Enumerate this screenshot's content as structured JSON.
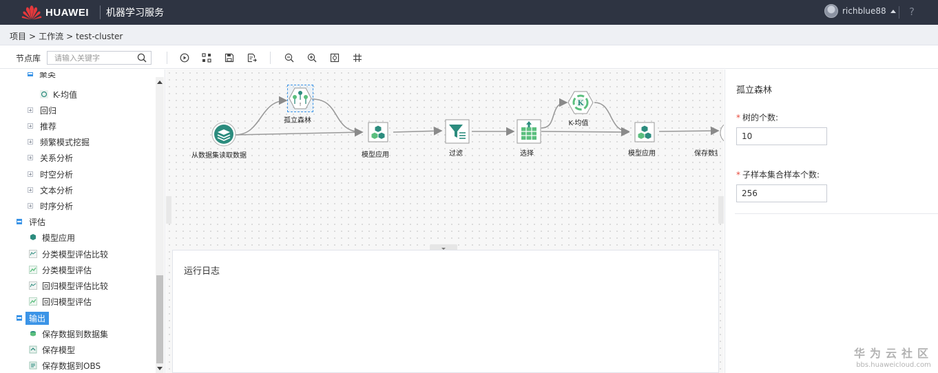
{
  "header": {
    "brand": "HUAWEI",
    "product": "机器学习服务",
    "username": "richblue88",
    "help_label": "?"
  },
  "breadcrumb": [
    "项目",
    ">",
    "工作流",
    ">",
    "test-cluster"
  ],
  "toolbar": {
    "library_label": "节点库",
    "search_placeholder": "请输入关键字",
    "buttons": [
      "run-icon",
      "layout-icon",
      "save-icon",
      "export-icon",
      "zoom-out-icon",
      "zoom-in-icon",
      "fit-screen-icon",
      "grid-icon"
    ]
  },
  "tree": {
    "cut_top_label": "聚类",
    "items": [
      {
        "label": "K-均值",
        "type": "leaf"
      },
      {
        "label": "回归",
        "type": "collapsed"
      },
      {
        "label": "推荐",
        "type": "collapsed"
      },
      {
        "label": "频繁模式挖掘",
        "type": "collapsed"
      },
      {
        "label": "关系分析",
        "type": "collapsed"
      },
      {
        "label": "时空分析",
        "type": "collapsed"
      },
      {
        "label": "文本分析",
        "type": "collapsed"
      },
      {
        "label": "时序分析",
        "type": "collapsed"
      },
      {
        "label": "评估",
        "type": "expanded"
      },
      {
        "label": "模型应用",
        "type": "leaf"
      },
      {
        "label": "分类模型评估比较",
        "type": "leaf"
      },
      {
        "label": "分类模型评估",
        "type": "leaf"
      },
      {
        "label": "回归模型评估比较",
        "type": "leaf"
      },
      {
        "label": "回归模型评估",
        "type": "leaf"
      },
      {
        "label": "输出",
        "type": "expanded-selected"
      },
      {
        "label": "保存数据到数据集",
        "type": "leaf"
      },
      {
        "label": "保存模型",
        "type": "leaf"
      },
      {
        "label": "保存数据到OBS",
        "type": "leaf"
      }
    ]
  },
  "flow": {
    "nodes": [
      {
        "id": "read",
        "label": "从数据集读取数据",
        "icon": "layers-icon"
      },
      {
        "id": "iforest",
        "label": "孤立森林",
        "icon": "forest-icon",
        "selected": true
      },
      {
        "id": "apply1",
        "label": "模型应用",
        "icon": "cubes-icon"
      },
      {
        "id": "filter",
        "label": "过滤",
        "icon": "filter-icon"
      },
      {
        "id": "select",
        "label": "选择",
        "icon": "table-select-icon"
      },
      {
        "id": "kmeans",
        "label": "K-均值",
        "icon": "kmeans-icon"
      },
      {
        "id": "apply2",
        "label": "模型应用",
        "icon": "cubes-icon"
      },
      {
        "id": "save",
        "label": "保存数据",
        "icon": "save-data-icon"
      }
    ]
  },
  "log": {
    "title": "运行日志"
  },
  "properties": {
    "title": "孤立森林",
    "fields": [
      {
        "label": "树的个数:",
        "value": "10",
        "required": true
      },
      {
        "label": "子样本集合样本个数:",
        "value": "256",
        "required": true
      }
    ]
  },
  "watermark": {
    "line1": "华为云社区",
    "line2": "bbs.huaweicloud.com"
  },
  "colors": {
    "topbar": "#2e3442",
    "accent": "#3b94e7",
    "required": "#e84a3c",
    "node_teal": "#2c8c7e",
    "node_green": "#5bbf7e"
  }
}
